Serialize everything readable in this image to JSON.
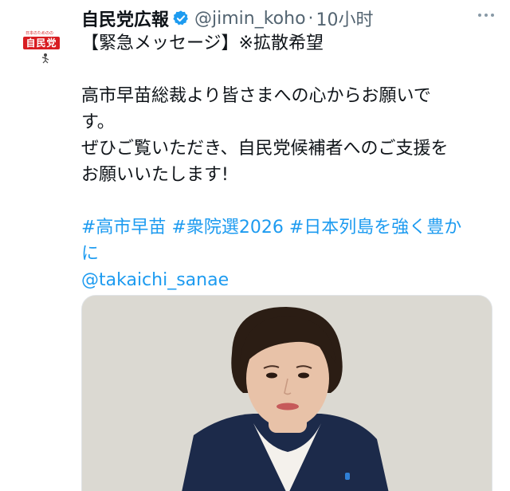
{
  "account": {
    "display_name": "自民党広報",
    "handle": "@jimin_koho",
    "separator": "·",
    "time": "10小时",
    "avatar_tagline": "日本のためのの",
    "avatar_logo_text": "自民党",
    "verified_icon": "verified-badge-icon"
  },
  "tweet": {
    "lines": [
      "【緊急メッセージ】※拡散希望",
      "高市早苗総裁より皆さまへの心からお願いで",
      "す。",
      "ぜひご覧いただき、自民党候補者へのご支援を",
      "お願いいたします!"
    ],
    "hashtags": [
      "#高市早苗",
      "#衆院選2026",
      "#日本列島を強く豊か"
    ],
    "hashtag_tail": "に",
    "mention": "@takaichi_sanae"
  },
  "media": {
    "type": "video-thumbnail",
    "colors": {
      "background": "#dbd9d2",
      "hair": "#2b1d14",
      "skin": "#e8c2a8",
      "jacket": "#1c2a4a",
      "shirt": "#f4f1ec",
      "lips": "#c65a5a"
    }
  },
  "colors": {
    "link": "#1d9bf0",
    "text": "#0f1419",
    "secondary": "#536471",
    "brand_red": "#d81d22"
  }
}
